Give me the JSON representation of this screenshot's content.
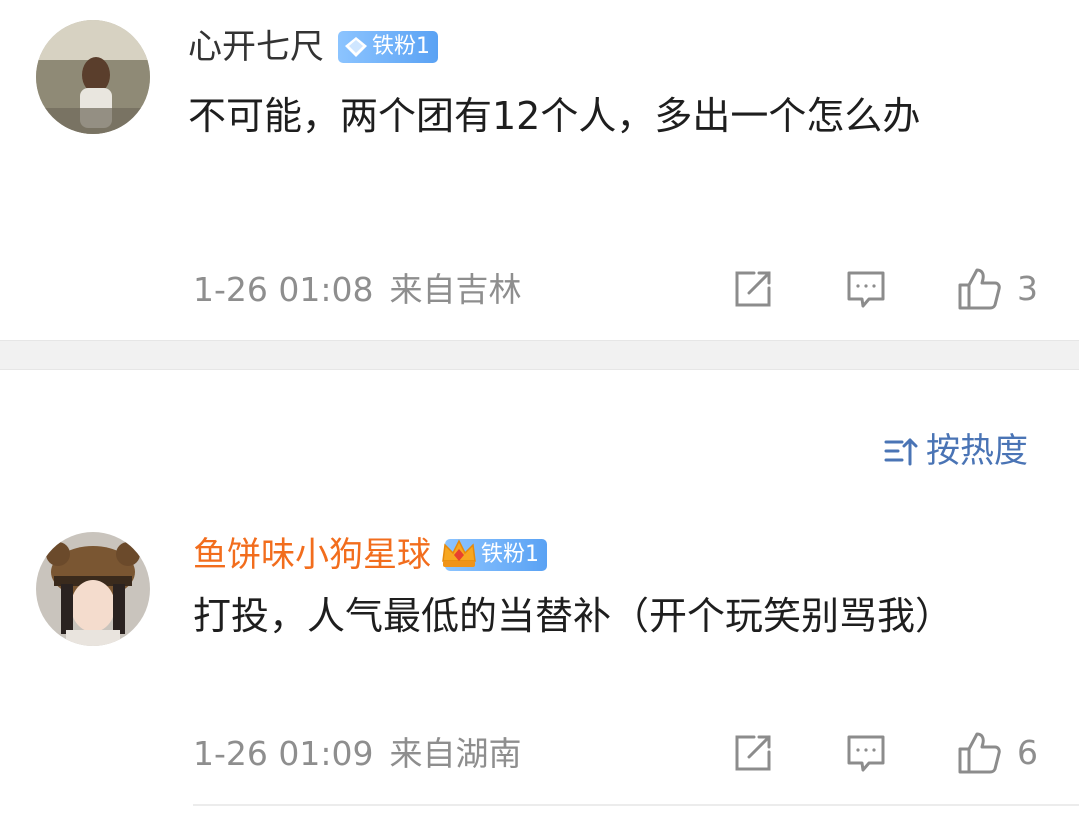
{
  "sort": {
    "label": "按热度",
    "icon": "sort-icon"
  },
  "comments": [
    {
      "username": "心开七尺",
      "badge": "铁粉1",
      "badge_icon": "diamond-icon",
      "content": "不可能，两个团有12个人，多出一个怎么办",
      "time": "1-26 01:08",
      "location": "来自吉林",
      "likes": "3",
      "username_color": "#333333"
    },
    {
      "username": "鱼饼味小狗星球",
      "badge": "铁粉1",
      "badge_icon": "crown-icon",
      "content": "打投，人气最低的当替补（开个玩笑别骂我）",
      "time": "1-26 01:09",
      "location": "来自湖南",
      "likes": "6",
      "username_color": "#f26d1d"
    }
  ]
}
